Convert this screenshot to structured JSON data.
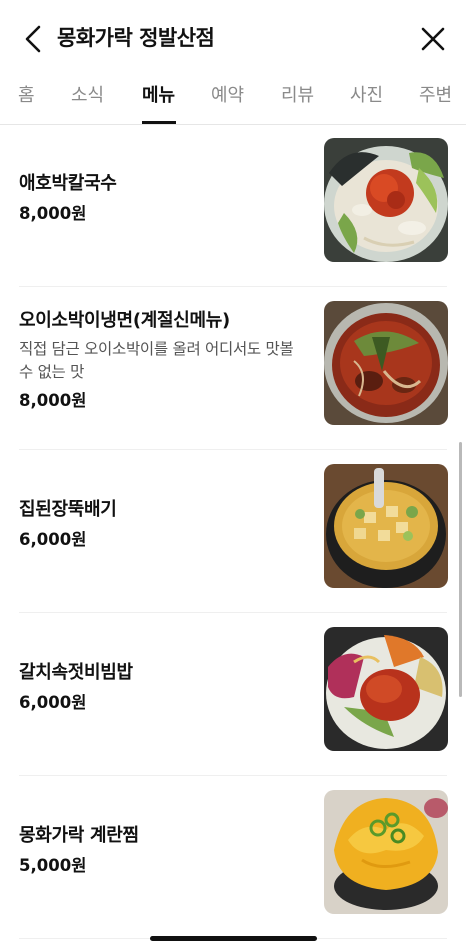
{
  "header": {
    "title": "몽화가락 정발산점",
    "back_icon": "chevron-left-icon",
    "close_icon": "close-icon"
  },
  "tabs": [
    {
      "label": "홈",
      "active": false
    },
    {
      "label": "소식",
      "active": false
    },
    {
      "label": "메뉴",
      "active": true
    },
    {
      "label": "예약",
      "active": false
    },
    {
      "label": "리뷰",
      "active": false
    },
    {
      "label": "사진",
      "active": false
    },
    {
      "label": "주변",
      "active": false
    }
  ],
  "menu": [
    {
      "name": "애호박칼국수",
      "desc": "",
      "price": "8,000원"
    },
    {
      "name": "오이소박이냉면(계절신메뉴)",
      "desc": "직접 담근 오이소박이를 올려 어디서도 맛볼 수 없는 맛",
      "price": "8,000원"
    },
    {
      "name": "집된장뚝배기",
      "desc": "",
      "price": "6,000원"
    },
    {
      "name": "갈치속젓비빔밥",
      "desc": "",
      "price": "6,000원"
    },
    {
      "name": "몽화가락 계란찜",
      "desc": "",
      "price": "5,000원"
    }
  ],
  "colors": {
    "text": "#111111",
    "tab_inactive": "#8a8a8a",
    "divider": "#efefef"
  }
}
